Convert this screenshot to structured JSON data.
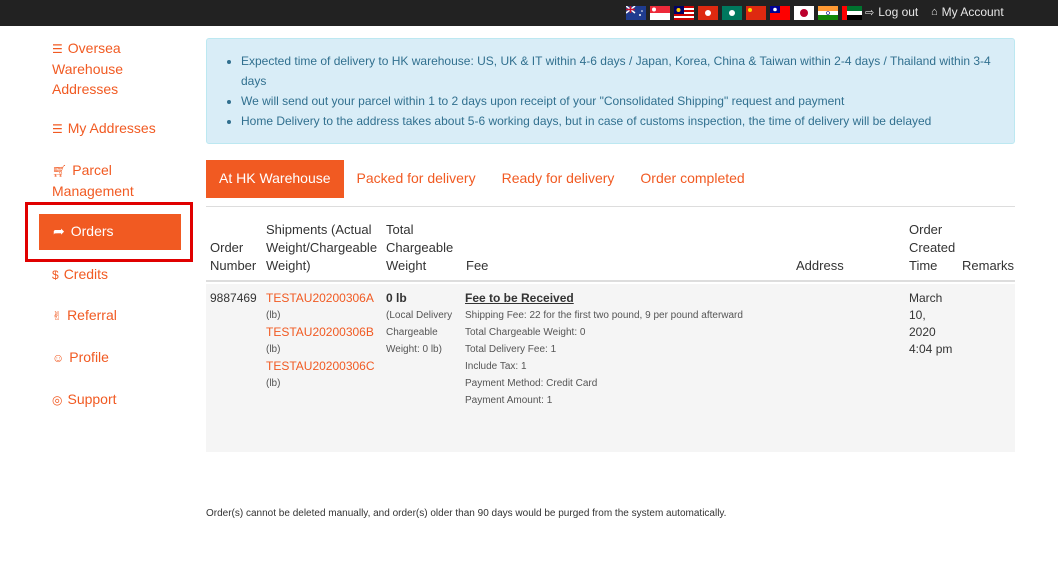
{
  "topbar": {
    "logout_label": "Log out",
    "myaccount_label": "My Account",
    "flags": [
      "australia-flag",
      "singapore-flag",
      "malaysia-flag",
      "hongkong-flag",
      "macau-flag",
      "china-flag",
      "taiwan-flag",
      "japan-flag",
      "india-flag",
      "uae-flag"
    ]
  },
  "sidebar": {
    "items": [
      {
        "label": "Oversea Warehouse Addresses"
      },
      {
        "label": "My Addresses"
      },
      {
        "label": "Parcel Management"
      },
      {
        "label": "Orders"
      },
      {
        "label": "Credits"
      },
      {
        "label": "Referral"
      },
      {
        "label": "Profile"
      },
      {
        "label": "Support"
      }
    ]
  },
  "notice": {
    "lines": [
      "Expected time of delivery to HK warehouse: US, UK & IT within 4-6 days / Japan, Korea, China & Taiwan within 2-4 days / Thailand within 3-4 days",
      "We will send out your parcel within 1 to 2 days upon receipt of your \"Consolidated Shipping\" request and payment",
      "Home Delivery to the address takes about 5-6 working days, but in case of customs inspection, the time of delivery will be delayed"
    ]
  },
  "tabs": [
    {
      "label": "At HK Warehouse"
    },
    {
      "label": "Packed for delivery"
    },
    {
      "label": "Ready for delivery"
    },
    {
      "label": "Order completed"
    }
  ],
  "table": {
    "headers": {
      "order_number": "Order Number",
      "shipments": "Shipments (Actual Weight/Chargeable Weight)",
      "total_weight": "Total Chargeable Weight",
      "fee": "Fee",
      "address": "Address",
      "created_time": "Order Created Time",
      "remarks": "Remarks"
    },
    "row": {
      "order_number": "9887469",
      "shipments": [
        {
          "id": "TESTAU20200306A",
          "unit": "(lb)"
        },
        {
          "id": "TESTAU20200306B",
          "unit": "(lb)"
        },
        {
          "id": "TESTAU20200306C",
          "unit": "(lb)"
        }
      ],
      "total_weight": "0 lb",
      "total_weight_note": "(Local Delivery Chargeable Weight: 0 lb)",
      "fee_title": "Fee to be Received",
      "fee_lines": [
        "Shipping Fee: 22 for the first two pound, 9 per pound afterward",
        "Total Chargeable Weight: 0",
        "Total Delivery Fee: 1",
        "Include Tax: 1",
        "Payment Method: Credit Card",
        "Payment Amount: 1"
      ],
      "created_time": "March 10, 2020 4:04 pm"
    }
  },
  "footer_note": "Order(s) cannot be deleted manually, and order(s) older than 90 days would be purged from the system automatically.",
  "colors": {
    "accent": "#f15a22",
    "topbar": "#222222",
    "notice_bg": "#d9edf7",
    "notice_text": "#31708f",
    "highlight": "#e00000"
  }
}
